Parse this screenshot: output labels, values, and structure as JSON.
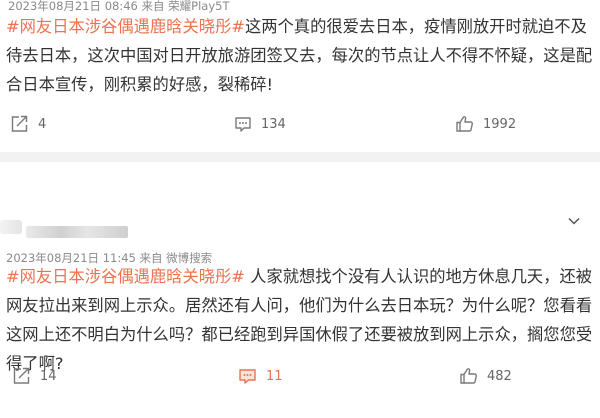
{
  "posts": [
    {
      "meta": "2023年08月21日 08:46  来自 荣耀Play5T",
      "hashtag": "#网友日本涉谷偶遇鹿晗关晓彤#",
      "body": "这两个真的很爱去日本，疫情刚放开时就迫不及待去日本，这次中国对日开放旅游团签又去，每次的节点让人不得不怀疑，这是配合日本宣传，刚积累的好感，裂稀碎!",
      "share_count": "4",
      "comment_count": "134",
      "like_count": "1992"
    },
    {
      "meta": "2023年08月21日 11:45  来自 微博搜索",
      "hashtag": "#网友日本涉谷偶遇鹿晗关晓彤#",
      "body": " 人家就想找个没有人认识的地方休息几天，还被网友拉出来到网上示众。居然还有人问，他们为什么去日本玩？为什么呢？您看看这网上还不明白为什么吗？都已经跑到异国休假了还要被放到网上示众，搁您您受得了啊?",
      "share_count": "14",
      "comment_count": "11",
      "like_count": "482"
    }
  ],
  "colors": {
    "hashtag": "#eb7350",
    "active_comment": "#eb7350",
    "meta_text": "#8a8a8a",
    "divider": "#f2f2f2"
  },
  "icons": [
    "share-icon",
    "comment-icon",
    "like-icon",
    "chevron-down-icon"
  ]
}
